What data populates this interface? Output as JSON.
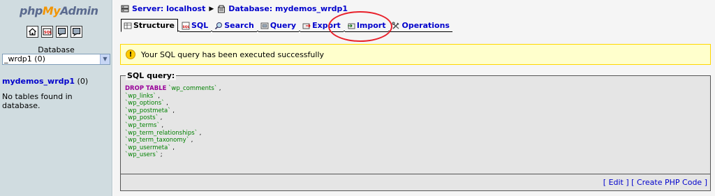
{
  "nav": {
    "logo": {
      "php": "php",
      "my": "My",
      "admin": "Admin"
    },
    "icons": [
      "home-icon",
      "sql-window-icon",
      "query-window-icon",
      "documentation-icon"
    ],
    "database_label": "Database",
    "database_select_value": "_wrdp1 (0)",
    "db_name": "mydemos_wrdp1",
    "db_count": " (0)",
    "no_tables": "No tables found in database."
  },
  "breadcrumb": {
    "server": "Server: localhost",
    "database": "Database: mydemos_wrdp1"
  },
  "tabs": [
    {
      "label": "Structure",
      "icon": "structure-icon",
      "active": true
    },
    {
      "label": "SQL",
      "icon": "sql-icon",
      "active": false
    },
    {
      "label": "Search",
      "icon": "search-icon",
      "active": false
    },
    {
      "label": "Query",
      "icon": "query-icon",
      "active": false
    },
    {
      "label": "Export",
      "icon": "export-icon",
      "active": false
    },
    {
      "label": "Import",
      "icon": "import-icon",
      "active": false
    },
    {
      "label": "Operations",
      "icon": "operations-icon",
      "active": false
    }
  ],
  "notice": {
    "message": "Your SQL query has been executed successfully",
    "icon": "warning-icon"
  },
  "sql": {
    "legend": "SQL query:",
    "keyword": "DROP TABLE",
    "tables": [
      "`wp_comments`",
      "`wp_links`",
      "`wp_options`",
      "`wp_postmeta`",
      "`wp_posts`",
      "`wp_terms`",
      "`wp_term_relationships`",
      "`wp_term_taxonomy`",
      "`wp_usermeta`",
      "`wp_users`"
    ],
    "edit_link": "Edit",
    "create_php_link": "Create PHP Code"
  },
  "colors": {
    "nav_bg": "#d0dce0",
    "link": "#0000cc",
    "keyword": "#990099",
    "identifier": "#008000",
    "annotation_circle": "#e8202a"
  }
}
